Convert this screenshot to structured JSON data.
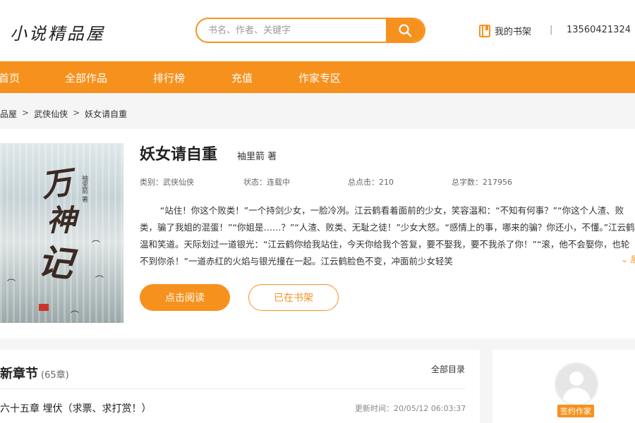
{
  "header": {
    "logo": "小说精品屋",
    "search_placeholder": "书名、作者、关键字",
    "bookshelf_label": "我的书架",
    "divider": "|",
    "user_phone": "13560421324"
  },
  "nav": {
    "items": [
      "首页",
      "全部作品",
      "排行榜",
      "充值",
      "作家专区"
    ]
  },
  "breadcrumb": {
    "items": [
      "精品屋",
      "武侠仙侠",
      "妖女请自重"
    ],
    "separator": ">"
  },
  "book": {
    "title": "妖女请自重",
    "author": "袖里箭 著",
    "category": "类别：武侠仙侠",
    "status": "状态：连载中",
    "clicks": "总点击：210",
    "words": "总字数：217956",
    "description": "“站住！你这个败类！”一个持剑少女，一脸冷冽。江云鹤看着面前的少女，笑容温和：“不知有何事？”“你这个人渣、败类，骗了我姐的混蛋！”“你姐是……？”“人渣、败类、无耻之徒！”少女大怒。“感情上的事，哪来的骗？你还小，不懂。”江云鹤温和笑道。天际划过一道银光：“江云鹤你给我站住，今天你给我个答复，要不娶我，要不我杀了你！”“滚，他不会娶你，也轮不到你杀！”一道赤红的火焰与银光撞在一起。江云鹤脸色不变，冲面前少女轻笑",
    "expand_label": "展开",
    "read_button": "点击阅读",
    "shelf_button": "已在书架",
    "cover": {
      "title_chars": [
        "万",
        "神",
        "记"
      ],
      "author_vertical": "袖里箭 著"
    }
  },
  "chapters": {
    "heading": "最新章节",
    "count": "(65章)",
    "all_label": "全部目录",
    "latest_title": "第六十五章 埋伏（求票、求打赏！）",
    "update_time": "更新时间：20/05/12 06:03:37"
  },
  "author_card": {
    "badge": "签约作家"
  },
  "colors": {
    "accent": "#f7911e",
    "background": "#f5f5f5"
  }
}
